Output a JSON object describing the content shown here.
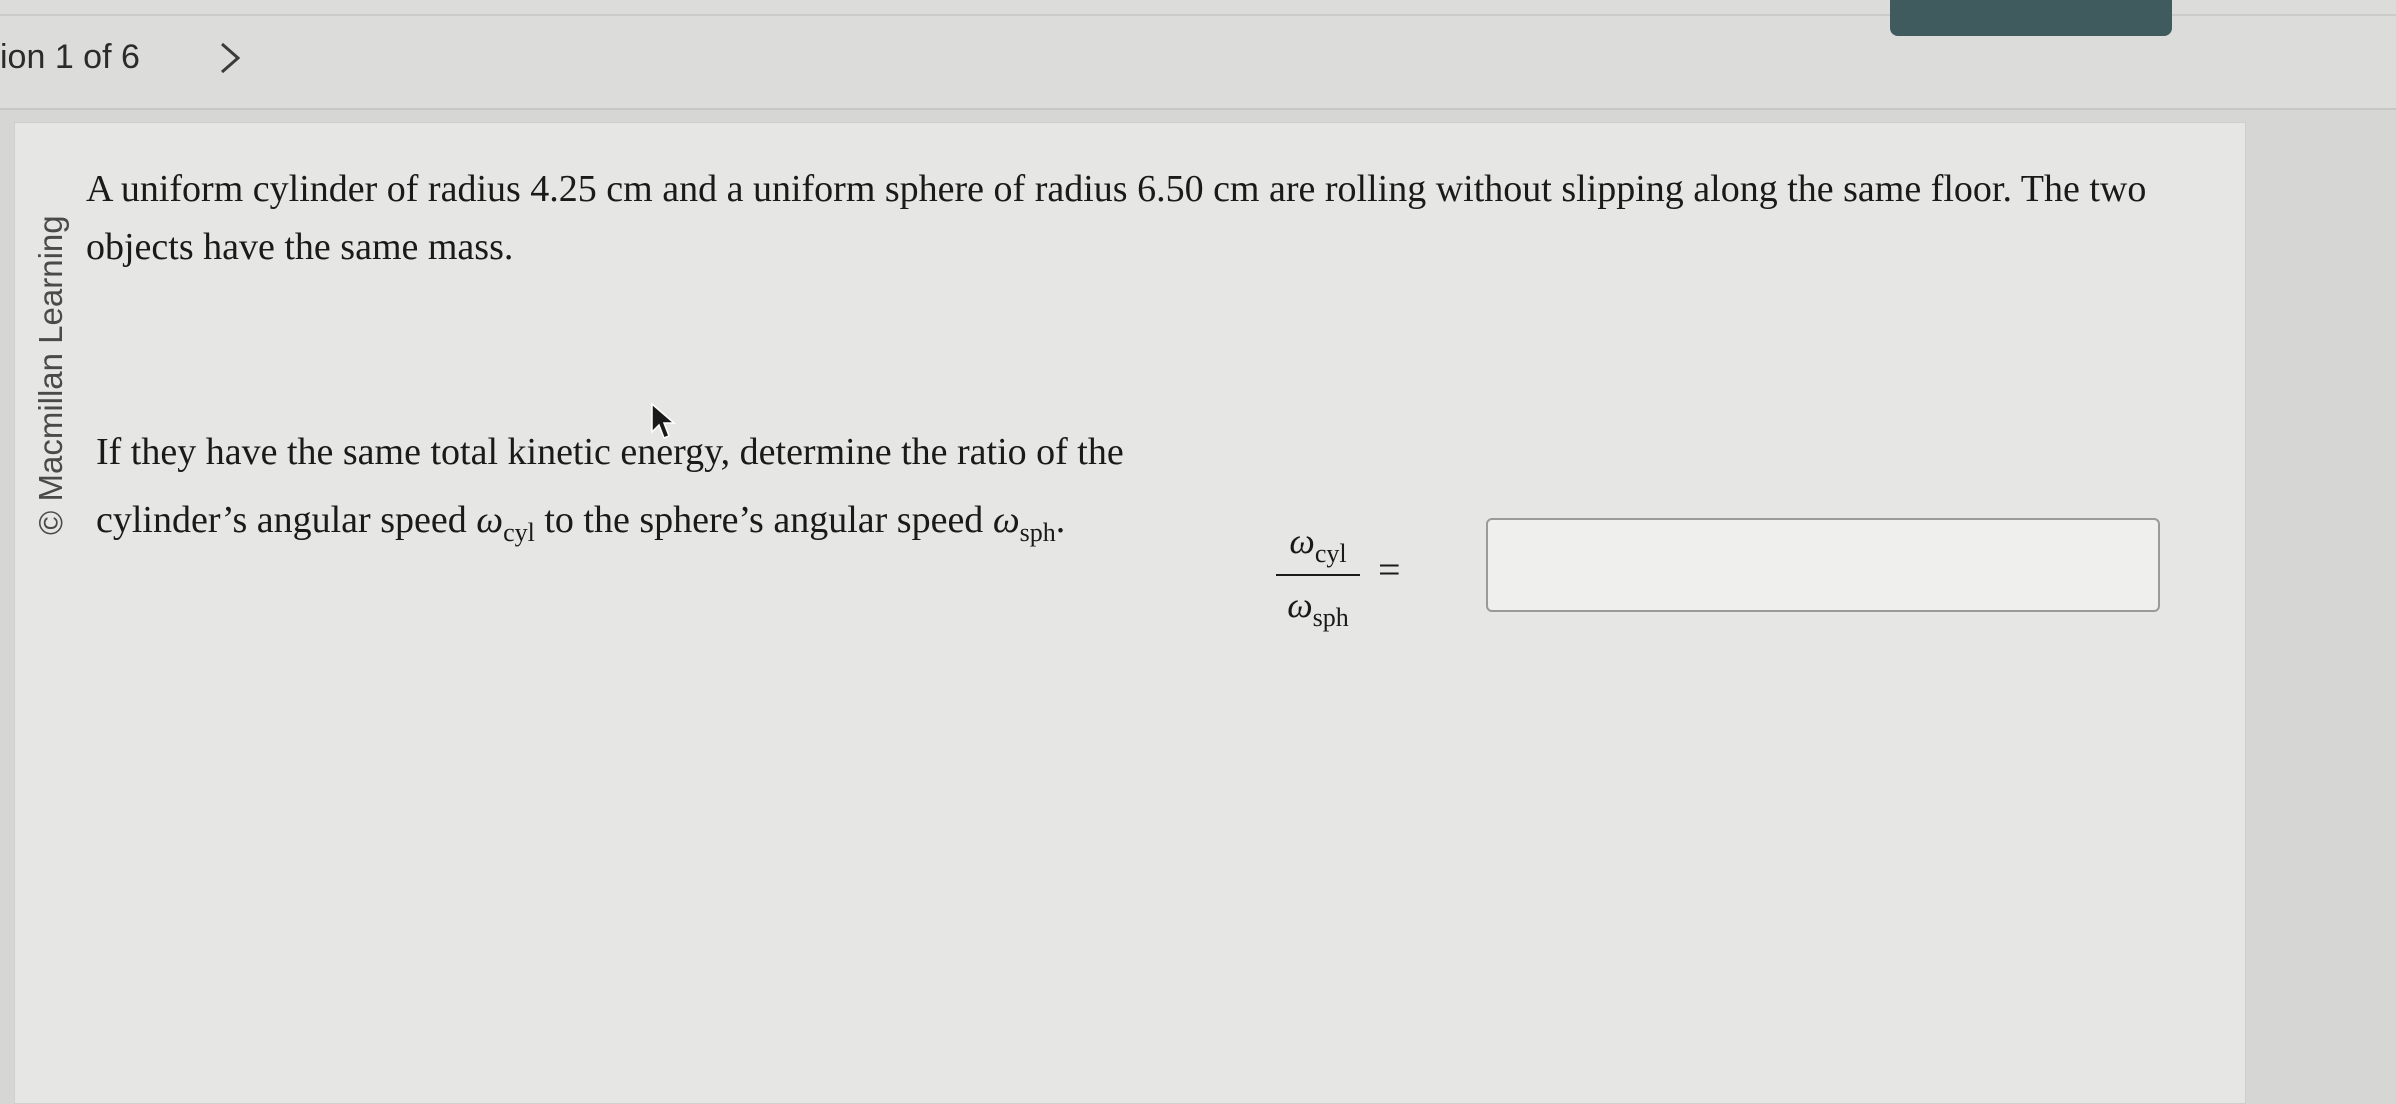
{
  "nav": {
    "label": "ion 1 of 6",
    "next_icon": "chevron-right-icon"
  },
  "copyright": "© Macmillan Learning",
  "problem": {
    "text": "A uniform cylinder of radius 4.25 cm and a uniform sphere of radius 6.50 cm are rolling without slipping along the same floor. The two objects have the same mass."
  },
  "question": {
    "part1": "If they have the same total kinetic energy, determine the ratio of the cylinder’s angular speed ",
    "omega_cyl_symbol": "ω",
    "omega_cyl_sub": "cyl",
    "part2": " to the sphere’s angular speed ",
    "omega_sph_symbol": "ω",
    "omega_sph_sub": "sph",
    "part3": "."
  },
  "answer": {
    "num_symbol": "ω",
    "num_sub": "cyl",
    "den_symbol": "ω",
    "den_sub": "sph",
    "equals": "=",
    "input_value": ""
  },
  "colors": {
    "page_background": "#d6d6d4",
    "card_background": "#e6e6e4",
    "answer_button": "#3f5b5e"
  }
}
